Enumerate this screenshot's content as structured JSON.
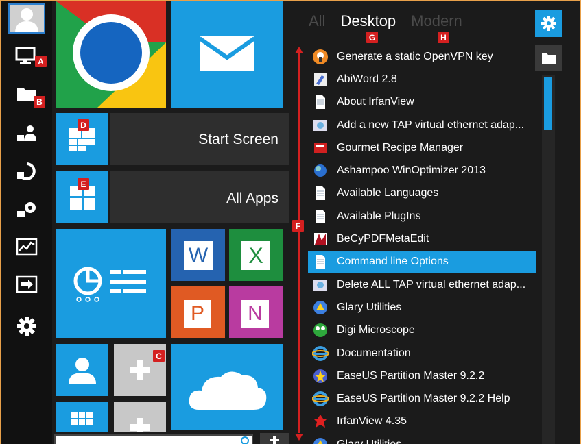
{
  "sidebar": {
    "items": [
      {
        "icon": "user-icon"
      },
      {
        "icon": "computer-icon",
        "badge": "A"
      },
      {
        "icon": "folder-icon",
        "badge": "B"
      },
      {
        "icon": "users-icon"
      },
      {
        "icon": "refresh-icon"
      },
      {
        "icon": "settings-tools-icon"
      },
      {
        "icon": "performance-icon"
      },
      {
        "icon": "switch-screen-icon"
      },
      {
        "icon": "gear-icon"
      }
    ]
  },
  "tiles": {
    "start_screen_label": "Start Screen",
    "all_apps_label": "All Apps",
    "badge_c": "C",
    "badge_d": "D",
    "badge_e": "E",
    "word_letter": "W",
    "excel_letter": "X",
    "powerpoint_letter": "P",
    "onenote_letter": "N"
  },
  "tabs": [
    {
      "label": "All",
      "active": false
    },
    {
      "label": "Desktop",
      "active": true,
      "badge": "G"
    },
    {
      "label": "Modern",
      "active": false,
      "badge": "H"
    }
  ],
  "scroll_marker": {
    "badge": "F"
  },
  "apps": [
    {
      "name": "Generate a static OpenVPN key",
      "icon": "openvpn-icon"
    },
    {
      "name": "AbiWord 2.8",
      "icon": "abiword-icon"
    },
    {
      "name": "About IrfanView",
      "icon": "document-icon"
    },
    {
      "name": "Add a new TAP virtual ethernet adap...",
      "icon": "network-icon"
    },
    {
      "name": "Gourmet Recipe Manager",
      "icon": "recipe-icon"
    },
    {
      "name": "Ashampoo WinOptimizer 2013",
      "icon": "ashampoo-icon"
    },
    {
      "name": "Available Languages",
      "icon": "document-icon"
    },
    {
      "name": "Available PlugIns",
      "icon": "document-icon"
    },
    {
      "name": "BeCyPDFMetaEdit",
      "icon": "pdf-icon"
    },
    {
      "name": "Command line Options",
      "icon": "document-icon",
      "selected": true
    },
    {
      "name": "Delete ALL TAP virtual ethernet adap...",
      "icon": "network-icon"
    },
    {
      "name": "Glary Utilities",
      "icon": "glary-icon"
    },
    {
      "name": "Digi Microscope",
      "icon": "microscope-icon"
    },
    {
      "name": "Documentation",
      "icon": "ie-icon"
    },
    {
      "name": "EaseUS Partition Master 9.2.2",
      "icon": "easeus-icon"
    },
    {
      "name": "EaseUS Partition Master 9.2.2 Help",
      "icon": "ie-icon"
    },
    {
      "name": "IrfanView 4.35",
      "icon": "irfanview-icon"
    },
    {
      "name": "Glary Utilities",
      "icon": "glary-icon"
    }
  ],
  "colors": {
    "accent": "#1a9ce0",
    "badge": "#d42020",
    "background": "#1b1b1b"
  }
}
